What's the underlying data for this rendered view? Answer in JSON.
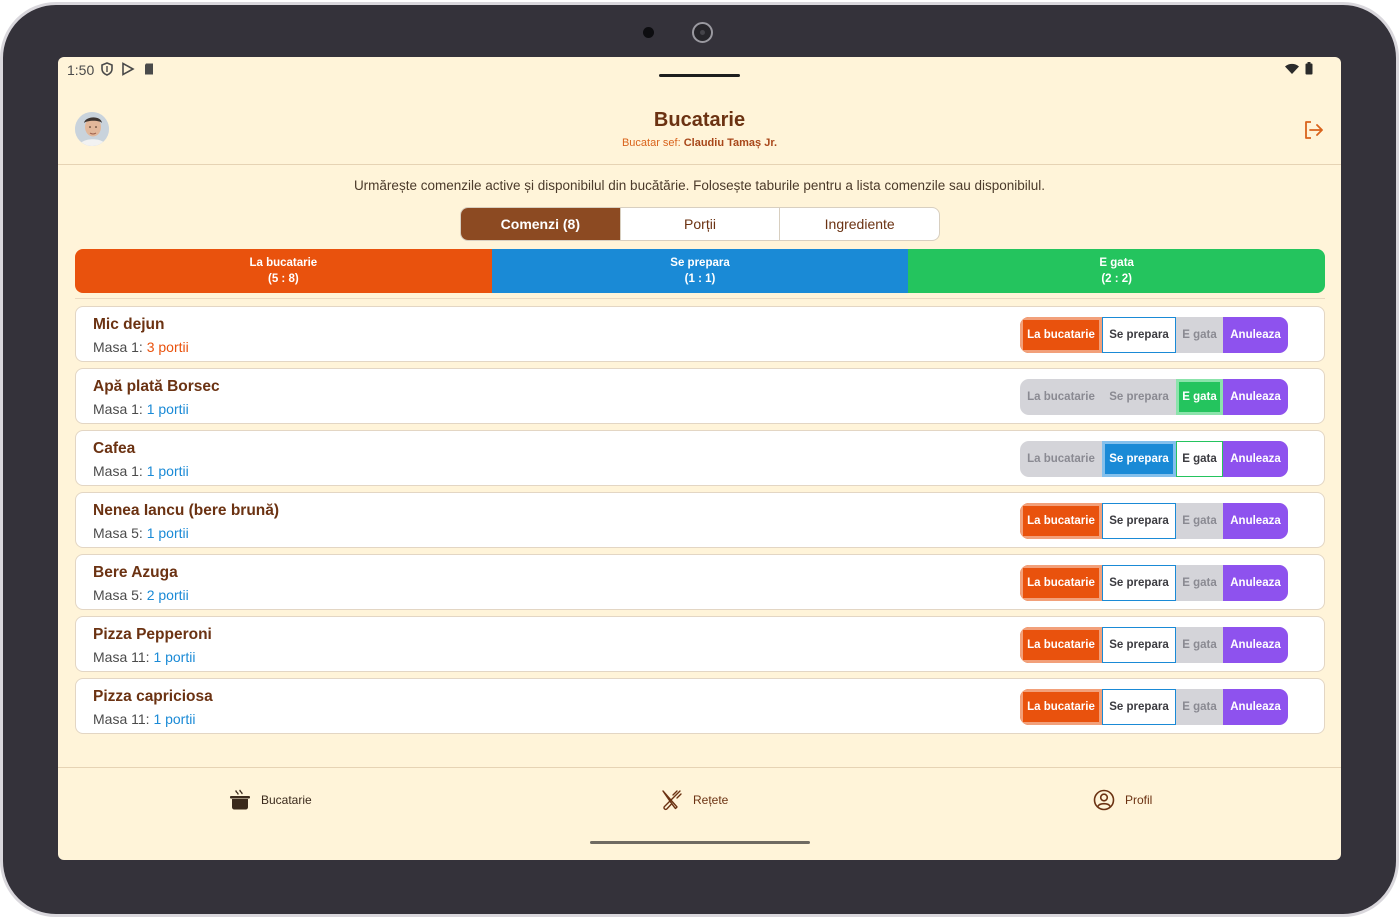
{
  "status_bar": {
    "time": "1:50"
  },
  "header": {
    "title": "Bucatarie",
    "subtitle_prefix": "Bucatar sef:",
    "chef_name": "Claudiu Tamaș Jr."
  },
  "intro": "Urmărește comenzile active și disponibilul din bucătărie. Folosește taburile pentru a lista comenzile sau disponibilul.",
  "tabs": [
    {
      "label": "Comenzi (8)"
    },
    {
      "label": "Porții"
    },
    {
      "label": "Ingrediente"
    }
  ],
  "summary": [
    {
      "label": "La bucatarie",
      "count": "(5 : 8)"
    },
    {
      "label": "Se prepara",
      "count": "(1 : 1)"
    },
    {
      "label": "E gata",
      "count": "(2 : 2)"
    }
  ],
  "buttons": {
    "kitchen": "La bucatarie",
    "preparing": "Se prepara",
    "ready": "E gata",
    "cancel": "Anuleaza"
  },
  "orders": [
    {
      "name": "Mic dejun",
      "table": "Masa 1:",
      "portions": "3 portii"
    },
    {
      "name": "Apă plată Borsec",
      "table": "Masa 1:",
      "portions": "1 portii"
    },
    {
      "name": "Cafea",
      "table": "Masa 1:",
      "portions": "1 portii"
    },
    {
      "name": "Nenea Iancu (bere brună)",
      "table": "Masa 5:",
      "portions": "1 portii"
    },
    {
      "name": "Bere Azuga",
      "table": "Masa 5:",
      "portions": "2 portii"
    },
    {
      "name": "Pizza Pepperoni",
      "table": "Masa 11:",
      "portions": "1 portii"
    },
    {
      "name": "Pizza capriciosa",
      "table": "Masa 11:",
      "portions": "1 portii"
    }
  ],
  "bottom_nav": [
    {
      "label": "Bucatarie",
      "icon": "pot-icon"
    },
    {
      "label": "Rețete",
      "icon": "utensils-icon"
    },
    {
      "label": "Profil",
      "icon": "user-circle-icon"
    }
  ],
  "colors": {
    "background": "#fff4d9",
    "brand_brown": "#8c4a22",
    "kitchen_orange": "#e9520d",
    "preparing_blue": "#1a8ad6",
    "ready_green": "#24c45e",
    "cancel_purple": "#8e52ee"
  }
}
